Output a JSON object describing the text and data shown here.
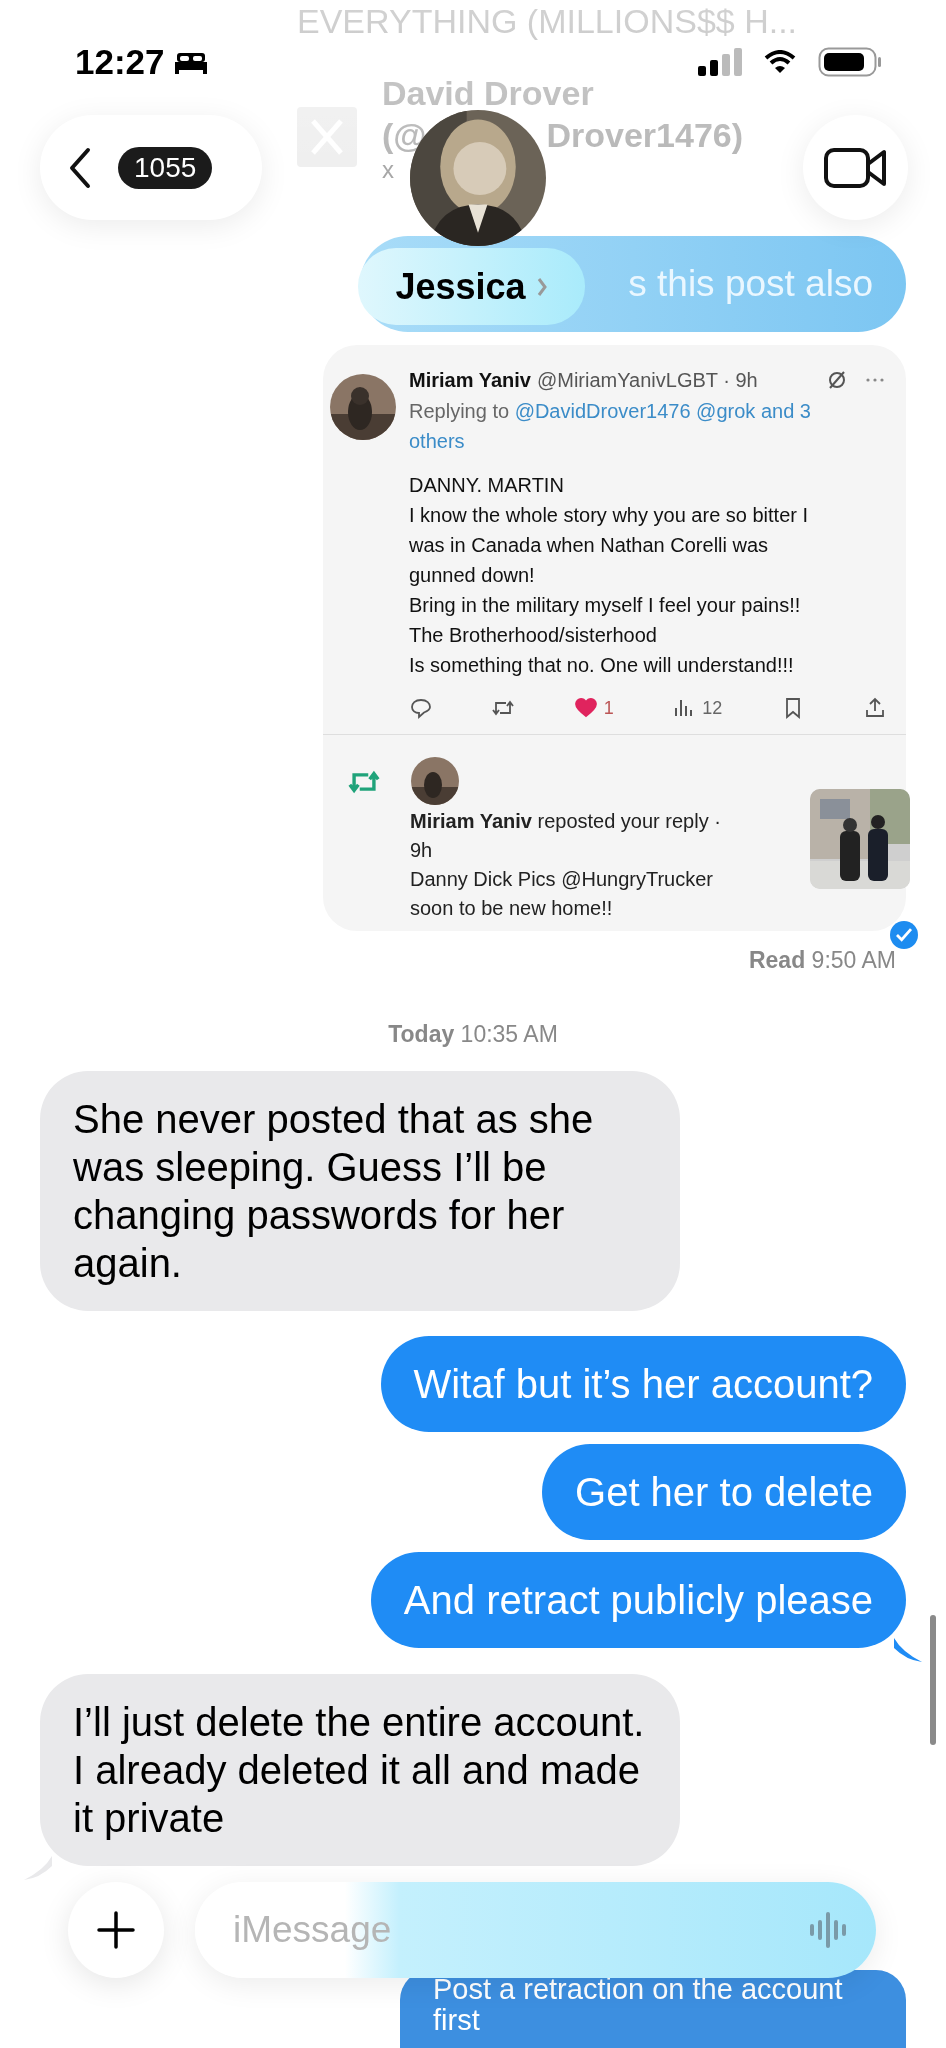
{
  "status_bar": {
    "time": "12:27"
  },
  "header": {
    "back_count": "1055",
    "contact_name": "Jessica"
  },
  "link_preview": {
    "title": "EVERYTHING (MILLIONS$$ H...",
    "author": "David Drover",
    "handle_start": "(@",
    "handle_end": "Drover1476)",
    "site": "x"
  },
  "messages": [
    {
      "kind": "sent_faded",
      "text": "s this post also"
    },
    {
      "kind": "tweet",
      "tweet": {
        "name": "Miriam Yaniv",
        "handle": "@MiriamYanivLGBT · 9h",
        "replying_prefix": "Replying to",
        "replying_targets": "@DavidDrover1476 @grok and 3 others",
        "lines": [
          "DANNY. MARTIN",
          "I know the whole story why you are so bitter I",
          "was in Canada when Nathan Corelli was",
          "gunned down!",
          "Bring in the military myself I feel your pains!!",
          "The Brotherhood/sisterhood",
          "Is something that no. One will understand!!!"
        ],
        "likes": "1",
        "liked": true,
        "views": "12",
        "repost": {
          "text": "**Miriam Yaniv** reposted your reply ·",
          "time": "9h",
          "lines": [
            "Danny Dick Pics @HungryTrucker",
            "soon to be new home!!"
          ]
        }
      }
    },
    {
      "kind": "receipt",
      "text": "**Read** 9:50 AM"
    },
    {
      "kind": "timestamp",
      "text": "**Today** 10:35 AM"
    },
    {
      "kind": "received",
      "text": "She never posted that as she was sleeping. Guess I’ll be changing passwords for her again."
    },
    {
      "kind": "sent",
      "text": "Witaf but it’s her account?"
    },
    {
      "kind": "sent",
      "text": "Get her to delete"
    },
    {
      "kind": "sent",
      "text": "And retract publicly please",
      "tail": true
    },
    {
      "kind": "received",
      "text": "I’ll just delete the entire account. I already deleted it all and made it private",
      "tail": true
    },
    {
      "kind": "sent_under",
      "text": "Post a retraction on the account first"
    }
  ],
  "composer": {
    "placeholder": "iMessage"
  }
}
